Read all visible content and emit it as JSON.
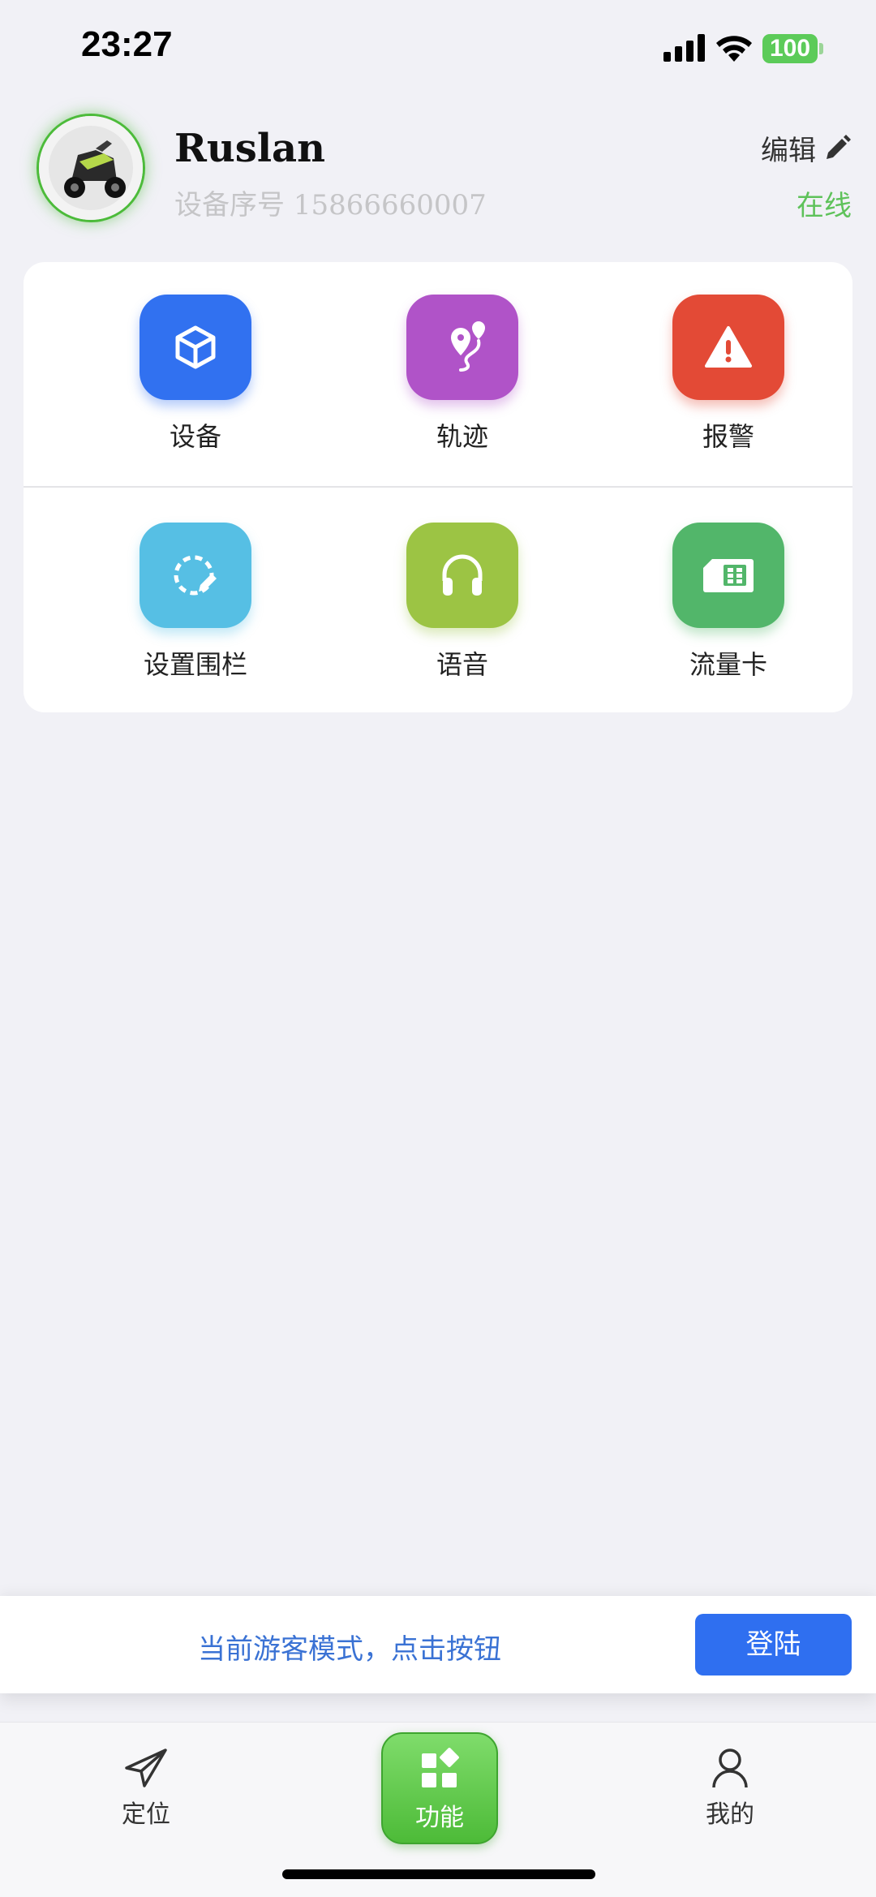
{
  "status_bar": {
    "time": "23:27",
    "battery": "100"
  },
  "profile": {
    "name": "Ruslan",
    "device_label": "设备序号",
    "device_number": "15866660007",
    "edit_label": "编辑",
    "status": "在线"
  },
  "menu": {
    "items": [
      {
        "label": "设备",
        "icon": "cube-icon",
        "color": "#3171f0"
      },
      {
        "label": "轨迹",
        "icon": "route-pin-icon",
        "color": "#b053c8"
      },
      {
        "label": "报警",
        "icon": "warning-icon",
        "color": "#e34a36"
      },
      {
        "label": "设置围栏",
        "icon": "fence-edit-icon",
        "color": "#56bfe4"
      },
      {
        "label": "语音",
        "icon": "headphones-icon",
        "color": "#9cc444"
      },
      {
        "label": "流量卡",
        "icon": "sim-card-icon",
        "color": "#52b66a"
      }
    ]
  },
  "guest_banner": {
    "text": "当前游客模式，点击按钮",
    "button": "登陆"
  },
  "tabbar": {
    "tabs": [
      {
        "label": "定位",
        "icon": "paper-plane-icon"
      },
      {
        "label": "功能",
        "icon": "apps-icon",
        "active": true
      },
      {
        "label": "我的",
        "icon": "person-icon"
      }
    ]
  },
  "colors": {
    "accent_green": "#4cbb3a",
    "online_green": "#5ec25a",
    "primary_blue": "#2f6ff0"
  }
}
